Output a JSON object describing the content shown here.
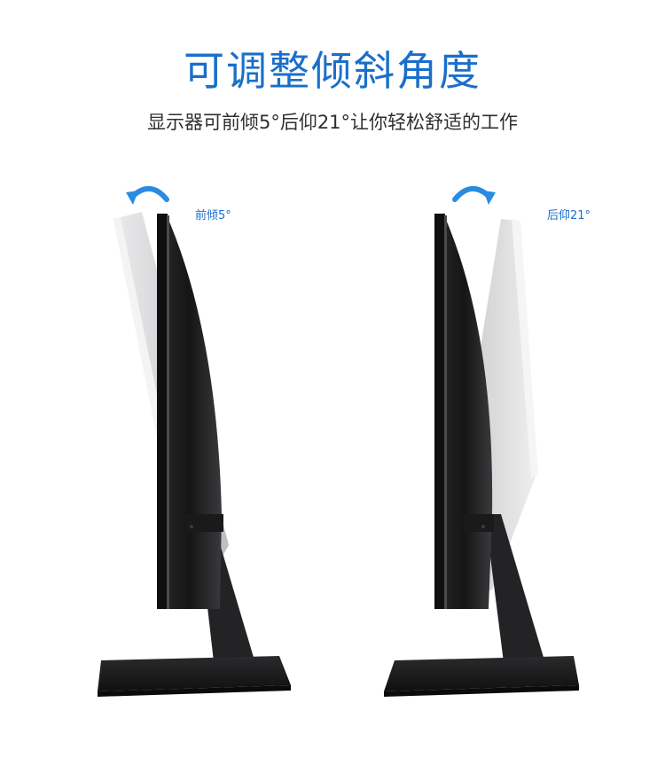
{
  "header": {
    "title": "可调整倾斜角度",
    "subtitle": "显示器可前倾5°后仰21°让你轻松舒适的工作"
  },
  "panels": [
    {
      "label": "前倾5°",
      "direction": "forward",
      "arrow_icon": "rotate-counterclockwise-arrow",
      "angle_deg": 5
    },
    {
      "label": "后仰21°",
      "direction": "backward",
      "arrow_icon": "rotate-clockwise-arrow",
      "angle_deg": 21
    }
  ],
  "colors": {
    "accent": "#1a6fc9",
    "monitor": "#1c1c1e",
    "ghost": "#c9c9cb",
    "text": "#2f2f2f"
  }
}
